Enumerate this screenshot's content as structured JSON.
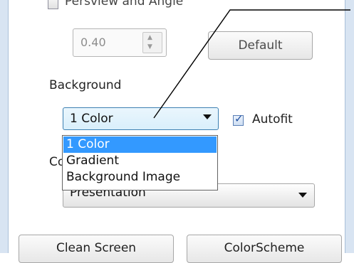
{
  "perspective": {
    "label": "Persview and Angle",
    "checked": false,
    "value": "0.40",
    "default_label": "Default"
  },
  "background": {
    "label": "Background",
    "selected": "1 Color",
    "options": [
      "1 Color",
      "Gradient",
      "Background Image"
    ],
    "autofit_label": "Autofit",
    "autofit_checked": true
  },
  "color_scheme": {
    "label_visible": "Co",
    "selected": "Presentation"
  },
  "buttons": {
    "clear_screen": "Clean Screen",
    "color_scheme": "ColorScheme"
  },
  "colors": {
    "highlight": "#3399ff",
    "focus_border": "#3c7fb1"
  }
}
